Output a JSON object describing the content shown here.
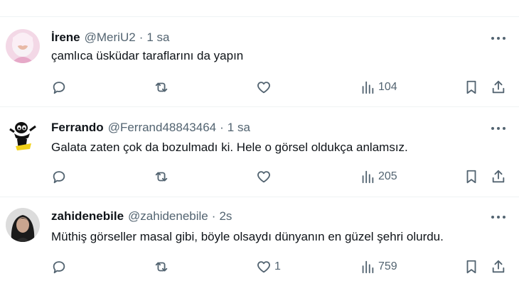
{
  "posts": [
    {
      "name": "İrene",
      "handle": "@MeriU2",
      "separator": "·",
      "time": "1 sa",
      "text": "çamlıca üsküdar taraflarını da yapın",
      "likes": "",
      "views": "104"
    },
    {
      "name": "Ferrando",
      "handle": "@Ferrand48843464",
      "separator": "·",
      "time": "1 sa",
      "text": "Galata zaten çok da bozulmadı ki. Hele o görsel oldukça anlamsız.",
      "likes": "",
      "views": "205"
    },
    {
      "name": "zahidenebile",
      "handle": "@zahidenebile",
      "separator": "·",
      "time": "2s",
      "text": "Müthiş görseller masal gibi, böyle olsaydı dünyanın en güzel şehri olurdu.",
      "likes": "1",
      "views": "759"
    }
  ],
  "icons": {
    "reply": "reply-icon",
    "repost": "repost-icon",
    "like": "heart-icon",
    "views": "views-icon",
    "bookmark": "bookmark-icon",
    "share": "share-icon",
    "more": "more-icon"
  },
  "colors": {
    "text": "#0f1419",
    "secondary": "#536471",
    "divider": "#eff3f4"
  }
}
